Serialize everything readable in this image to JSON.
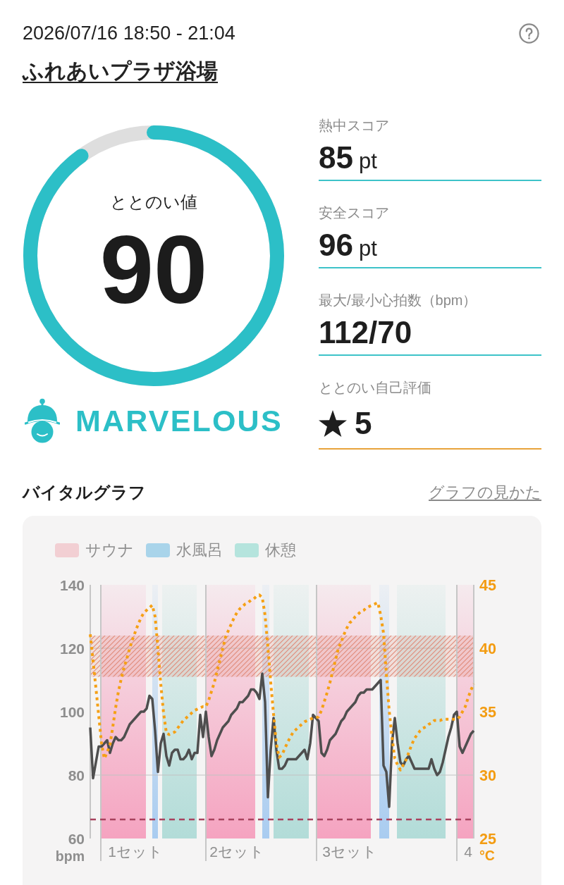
{
  "header": {
    "datetime": "2026/07/16 18:50 - 21:04",
    "facility": "ふれあいプラザ浴場"
  },
  "score": {
    "label": "ととのい値",
    "value": "90",
    "level": 0.9,
    "grade": "MARVELOUS"
  },
  "stats": [
    {
      "kind": "value",
      "label": "熱中スコア",
      "value": "85",
      "unit": "pt"
    },
    {
      "kind": "value",
      "label": "安全スコア",
      "value": "96",
      "unit": "pt"
    },
    {
      "kind": "value",
      "label": "最大/最小心拍数（bpm）",
      "value": "112/70"
    },
    {
      "kind": "rating",
      "label": "ととのい自己評価",
      "value": "5"
    }
  ],
  "vital_graph": {
    "title": "バイタルグラフ",
    "guide_link": "グラフの見かた",
    "legend": [
      {
        "label": "サウナ",
        "color": "#f2cfd3"
      },
      {
        "label": "水風呂",
        "color": "#a9d4ea"
      },
      {
        "label": "休憩",
        "color": "#b5e4dd"
      }
    ],
    "heart_rate": {
      "chart_data": {
        "type": "line",
        "ylabel": "bpm",
        "ylim": [
          60,
          140
        ],
        "yticks": [
          60,
          80,
          100,
          120,
          140
        ],
        "categories": [
          null,
          null,
          null,
          null,
          null,
          null,
          null,
          null,
          null,
          null,
          null,
          null,
          null,
          null,
          null,
          null,
          "1セット",
          null,
          null,
          null,
          null,
          null,
          null,
          null,
          null,
          null,
          null,
          null,
          null,
          null,
          null,
          null,
          null,
          null,
          null,
          null,
          null,
          null,
          null,
          null,
          null,
          null,
          null,
          null,
          null,
          null,
          null,
          null,
          null,
          null,
          null,
          null,
          "2セット",
          null,
          null,
          null,
          null,
          null,
          null,
          null,
          null,
          null,
          null,
          null,
          null,
          null,
          null,
          null,
          null,
          null,
          null,
          null,
          null,
          null,
          null,
          null,
          null,
          null,
          null,
          null,
          null,
          null,
          null,
          null,
          null,
          null,
          null,
          null,
          null,
          null,
          null,
          null,
          "3セット",
          null,
          null,
          null,
          null,
          null,
          null,
          null,
          null,
          null,
          null,
          null,
          null,
          null,
          null,
          null,
          null,
          null,
          null,
          null,
          null,
          null,
          null,
          null,
          null,
          null,
          null,
          null,
          null,
          null,
          null,
          null,
          null,
          null,
          null,
          null,
          null,
          null,
          null,
          null,
          null,
          null,
          "4",
          null,
          null
        ],
        "series": [
          {
            "color": "#4e4e4e",
            "line_style": "solid",
            "values": [
              95,
              79,
              84,
              89,
              89,
              90,
              91,
              87,
              90,
              92,
              91,
              91,
              92,
              94,
              96,
              97,
              98,
              99,
              100,
              100,
              101,
              105,
              104,
              94,
              81,
              90,
              93,
              86,
              83,
              87,
              88,
              88,
              85,
              85,
              86,
              88,
              85,
              87,
              87,
              99,
              92,
              100,
              92,
              86,
              88,
              91,
              93,
              95,
              96,
              97,
              99,
              100,
              101,
              103,
              103,
              104,
              105,
              107,
              107,
              106,
              104,
              112,
              103,
              73,
              88,
              98,
              88,
              82,
              82,
              83,
              85,
              85,
              85,
              85,
              86,
              87,
              88,
              85,
              90,
              99,
              98,
              97,
              87,
              86,
              88,
              91,
              92,
              93,
              95,
              97,
              98,
              100,
              101,
              102,
              103,
              105,
              106,
              106,
              107,
              107,
              107,
              108,
              109,
              110,
              83,
              81,
              70,
              90,
              98,
              90,
              84,
              83,
              85,
              86,
              84,
              82,
              82,
              82,
              82,
              82,
              82,
              85,
              82,
              80,
              81,
              84,
              88,
              92,
              95,
              99,
              100,
              89,
              87,
              89,
              91,
              93,
              94
            ]
          }
        ],
        "bands": [
          {
            "axis": "y",
            "from": 111,
            "to": 124,
            "color": "#e08a78"
          }
        ],
        "ref_lines": [
          {
            "axis": "y",
            "value": 80,
            "color": "#c2c2c2"
          },
          {
            "axis": "y",
            "value": 120,
            "color": "#c2c2c2"
          }
        ]
      }
    },
    "temperature": {
      "chart_data": {
        "type": "line",
        "ylabel": "°C",
        "ylim": [
          25,
          45
        ],
        "yticks": [
          25,
          30,
          35,
          40,
          45
        ],
        "series": [
          {
            "color": "#f5a015",
            "line_style": "dotted",
            "values": [
              41.1,
              39.0,
              36.9,
              34.7,
              32.5,
              31.3,
              31.8,
              32.4,
              33.8,
              35.3,
              36.6,
              37.6,
              38.5,
              39.2,
              40.0,
              40.7,
              41.3,
              41.9,
              42.4,
              42.8,
              43.0,
              43.2,
              43.4,
              42.5,
              40.0,
              37.2,
              34.9,
              33.3,
              33.2,
              33.3,
              33.4,
              33.7,
              34.0,
              34.3,
              34.5,
              34.7,
              34.9,
              35.1,
              35.2,
              35.3,
              35.4,
              35.4,
              35.9,
              36.6,
              37.3,
              38.2,
              39.1,
              40.0,
              40.9,
              41.4,
              41.9,
              42.4,
              42.8,
              43.1,
              43.3,
              43.5,
              43.6,
              43.8,
              43.9,
              44.1,
              44.2,
              44.0,
              42.6,
              40.1,
              37.3,
              34.8,
              32.5,
              31.4,
              31.6,
              32.1,
              32.6,
              33.0,
              33.4,
              33.6,
              33.8,
              34.0,
              34.2,
              34.3,
              34.4,
              34.5,
              34.5,
              34.6,
              35.1,
              35.8,
              36.5,
              37.3,
              38.2,
              39.1,
              40.0,
              40.5,
              41.1,
              41.6,
              42.0,
              42.2,
              42.5,
              42.7,
              42.9,
              43.0,
              43.2,
              43.3,
              43.4,
              43.5,
              43.6,
              42.6,
              41.2,
              38.0,
              35.1,
              33.0,
              31.3,
              30.8,
              30.4,
              30.8,
              31.2,
              31.8,
              32.4,
              32.9,
              33.2,
              33.5,
              33.7,
              33.8,
              34.0,
              34.1,
              34.3,
              34.3,
              34.3,
              34.4,
              34.4,
              34.4,
              34.4,
              34.4,
              34.4,
              34.6,
              35.0,
              35.4,
              36.1,
              36.7,
              37.2
            ]
          }
        ],
        "ref_lines": [
          {
            "axis": "y",
            "value": 26.5,
            "color": "#a8425e"
          }
        ]
      }
    }
  }
}
